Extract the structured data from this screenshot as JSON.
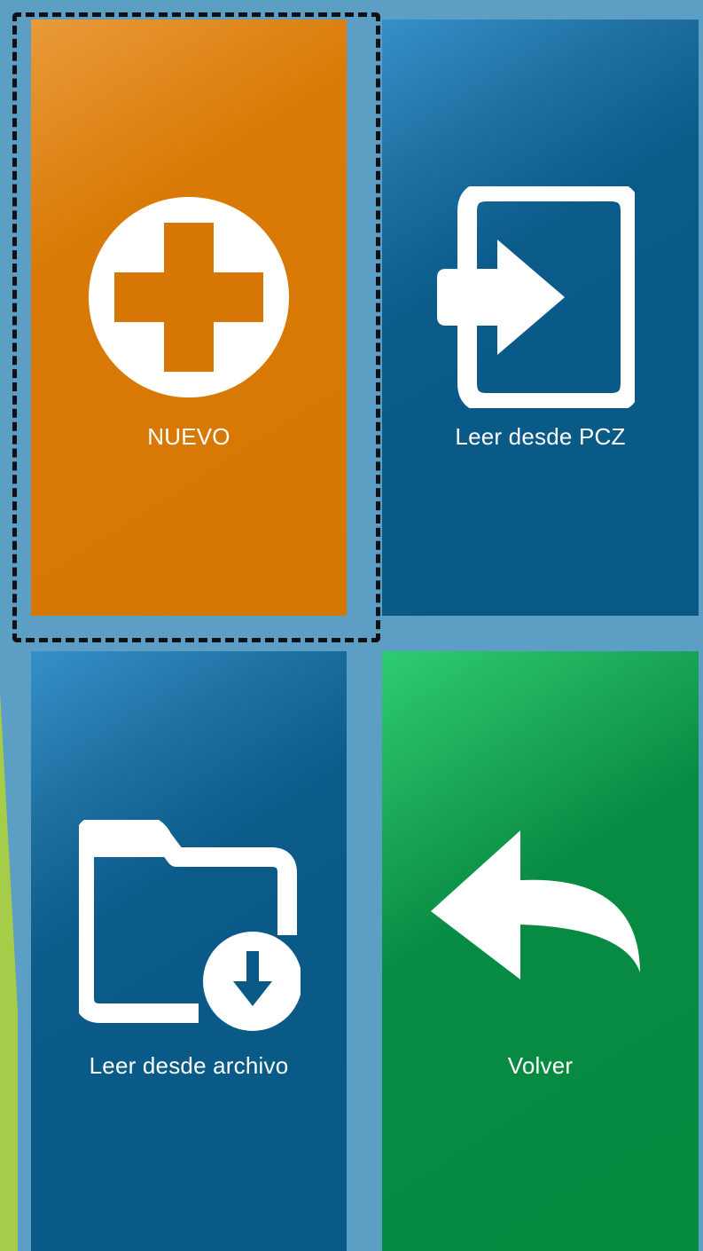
{
  "tiles": {
    "nuevo": {
      "label": "NUEVO",
      "icon": "plus-circle-icon",
      "color": "#d97a06"
    },
    "pcz": {
      "label": "Leer desde PCZ",
      "icon": "import-icon",
      "color": "#095986"
    },
    "archivo": {
      "label": "Leer desde archivo",
      "icon": "folder-download-icon",
      "color": "#095986"
    },
    "volver": {
      "label": "Volver",
      "icon": "back-arrow-icon",
      "color": "#068a40"
    }
  },
  "colors": {
    "background": "#5c9ec4",
    "accent_wedge": "#a6cd4a",
    "selection_outline": "#111111"
  }
}
